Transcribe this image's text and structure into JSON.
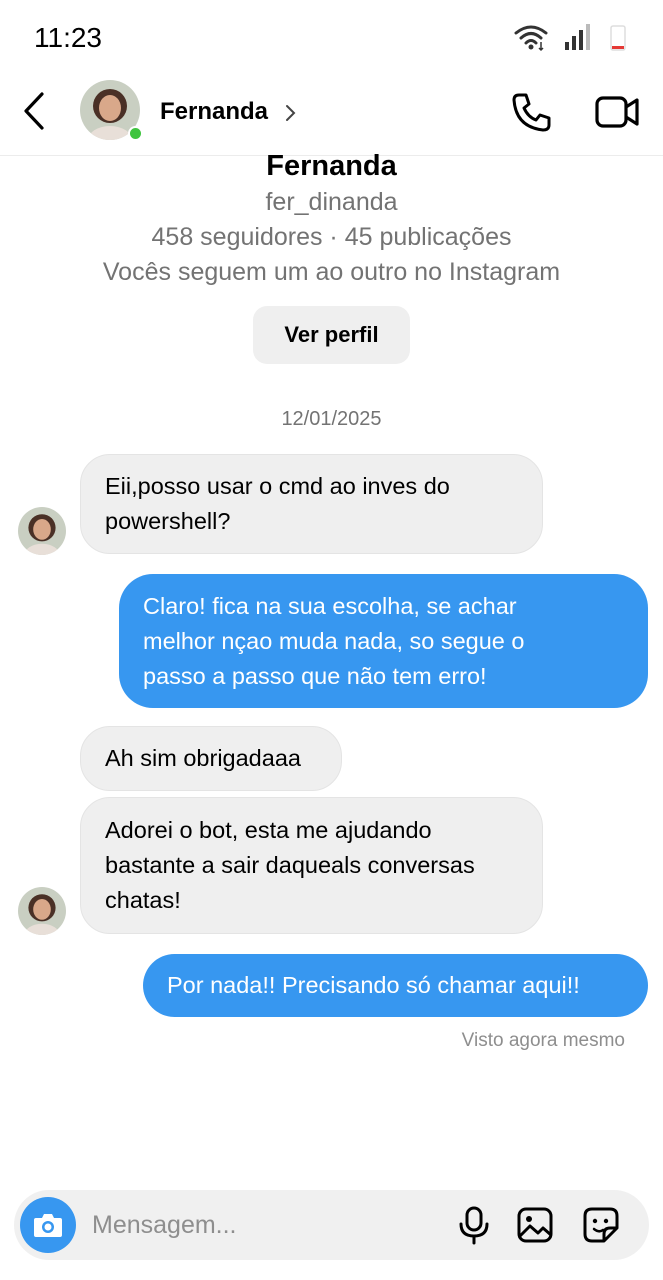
{
  "status_bar": {
    "time": "11:23",
    "icons": [
      "wifi-icon",
      "signal-icon",
      "battery-icon"
    ]
  },
  "header": {
    "contact_name": "Fernanda",
    "online": true
  },
  "profile": {
    "name": "Fernanda",
    "username": "fer_dinanda",
    "stats": "458 seguidores · 45 publicações",
    "mutual": "Vocês seguem um ao outro no Instagram",
    "view_profile_label": "Ver perfil"
  },
  "date_separator": "12/01/2025",
  "messages": [
    {
      "from": "contact",
      "lines": [
        "Eii,posso usar o cmd ao inves do",
        "powershell?"
      ]
    },
    {
      "from": "me",
      "lines": [
        "Claro! fica na sua escolha, se achar",
        "melhor nçao muda nada, so segue o",
        "passo a passo que não tem erro!"
      ]
    },
    {
      "from": "contact",
      "lines": [
        "Ah sim obrigadaaa"
      ]
    },
    {
      "from": "contact",
      "lines": [
        "Adorei o bot, esta me ajudando",
        "bastante a sair daqueals conversas",
        "chatas!"
      ]
    },
    {
      "from": "me",
      "lines": [
        "Por nada!! Precisando só chamar aqui!!"
      ]
    }
  ],
  "seen_status": "Visto agora mesmo",
  "composer": {
    "placeholder": "Mensagem..."
  },
  "colors": {
    "outgoing_bubble": "#3797f0",
    "incoming_bubble": "#efefef",
    "online_dot": "#3ec43e"
  }
}
